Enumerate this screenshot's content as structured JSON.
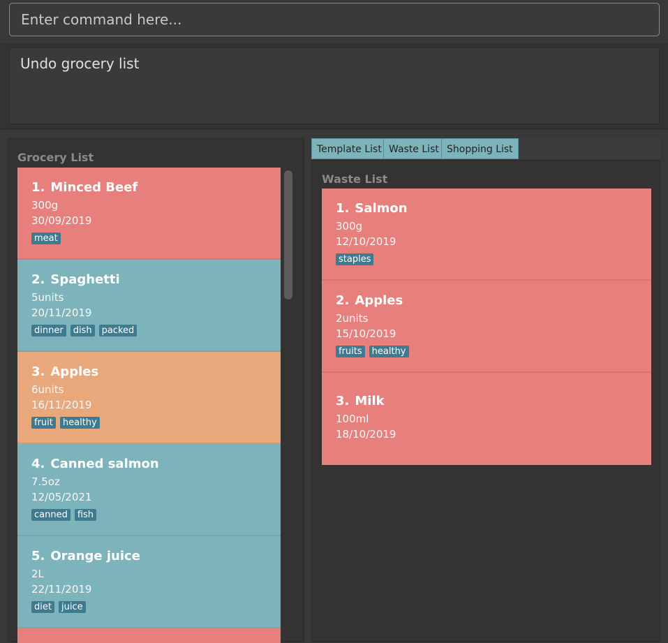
{
  "command": {
    "placeholder": "Enter command here..."
  },
  "result": {
    "text": "Undo grocery list"
  },
  "grocery": {
    "title": "Grocery List",
    "items": [
      {
        "index": "1.",
        "name": "Minced Beef",
        "amount": "300g",
        "date": "30/09/2019",
        "tags": [
          "meat"
        ],
        "color": "#e77f7c"
      },
      {
        "index": "2.",
        "name": "Spaghetti",
        "amount": "5units",
        "date": "20/11/2019",
        "tags": [
          "dinner",
          "dish",
          "packed"
        ],
        "color": "#7db4bc"
      },
      {
        "index": "3.",
        "name": "Apples",
        "amount": "6units",
        "date": "16/11/2019",
        "tags": [
          "fruit",
          "healthy"
        ],
        "color": "#e9a87b"
      },
      {
        "index": "4.",
        "name": "Canned salmon",
        "amount": "7.5oz",
        "date": "12/05/2021",
        "tags": [
          "canned",
          "fish"
        ],
        "color": "#7db4bc"
      },
      {
        "index": "5.",
        "name": "Orange juice",
        "amount": "2L",
        "date": "22/11/2019",
        "tags": [
          "diet",
          "juice"
        ],
        "color": "#7db4bc"
      }
    ]
  },
  "tabs": [
    {
      "label": "Template List"
    },
    {
      "label": "Waste List"
    },
    {
      "label": "Shopping List"
    }
  ],
  "waste": {
    "title": "Waste List",
    "items": [
      {
        "index": "1.",
        "name": "Salmon",
        "amount": "300g",
        "date": "12/10/2019",
        "tags": [
          "staples"
        ],
        "color": "#e77f7c"
      },
      {
        "index": "2.",
        "name": "Apples",
        "amount": "2units",
        "date": "15/10/2019",
        "tags": [
          "fruits",
          "healthy"
        ],
        "color": "#e77f7c"
      },
      {
        "index": "3.",
        "name": "Milk",
        "amount": "100ml",
        "date": "18/10/2019",
        "tags": [],
        "color": "#e77f7c"
      }
    ]
  }
}
